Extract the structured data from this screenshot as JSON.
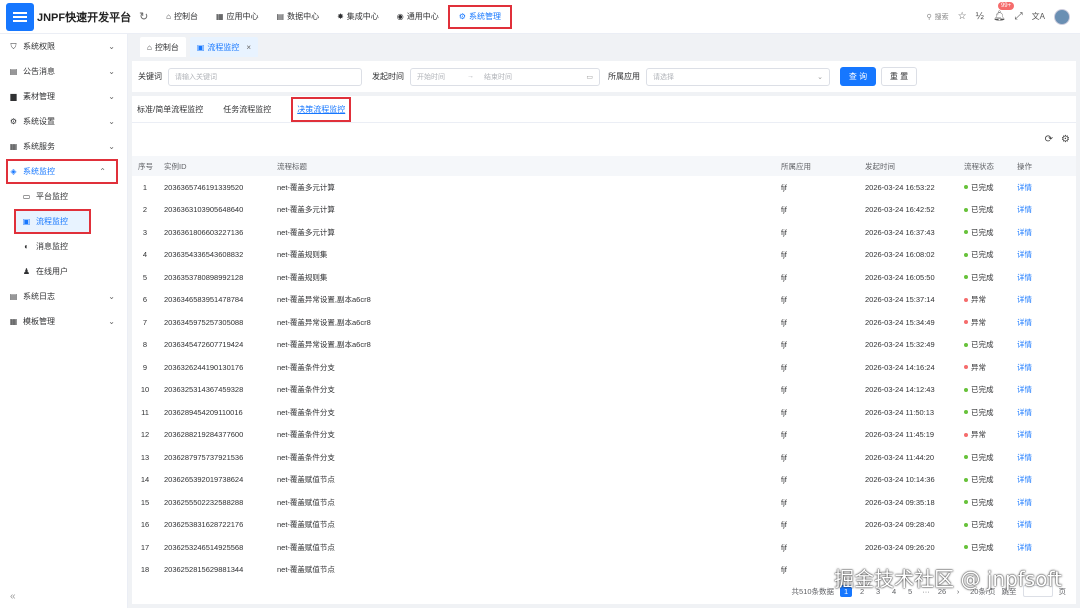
{
  "header": {
    "app_name": "JNPF快速开发平台",
    "nav": [
      {
        "label": "控制台",
        "icon": "home-icon",
        "active": false
      },
      {
        "label": "应用中心",
        "icon": "app-icon",
        "active": false
      },
      {
        "label": "数据中心",
        "icon": "data-icon",
        "active": false
      },
      {
        "label": "集成中心",
        "icon": "integration-icon",
        "active": false
      },
      {
        "label": "通用中心",
        "icon": "general-icon",
        "active": false
      },
      {
        "label": "系统管理",
        "icon": "gear-icon",
        "active": true
      }
    ],
    "search_label": "搜索",
    "badge": "99+"
  },
  "sidebar": {
    "items": [
      {
        "label": "系统权限",
        "icon": "shield-icon",
        "chev": "⌄"
      },
      {
        "label": "公告消息",
        "icon": "notice-icon",
        "chev": "⌄"
      },
      {
        "label": "素材管理",
        "icon": "folder-icon",
        "chev": "⌄"
      },
      {
        "label": "系统设置",
        "icon": "settings-icon",
        "chev": "⌄"
      },
      {
        "label": "系统服务",
        "icon": "service-icon",
        "chev": "⌄"
      },
      {
        "label": "系统监控",
        "icon": "monitor-icon",
        "chev": "⌃"
      },
      {
        "label": "平台监控",
        "icon": "platform-icon"
      },
      {
        "label": "流程监控",
        "icon": "flow-icon"
      },
      {
        "label": "消息监控",
        "icon": "message-icon"
      },
      {
        "label": "在线用户",
        "icon": "user-icon"
      },
      {
        "label": "系统日志",
        "icon": "log-icon",
        "chev": "⌄"
      },
      {
        "label": "模板管理",
        "icon": "template-icon",
        "chev": "⌄"
      }
    ]
  },
  "tabs": [
    {
      "label": "控制台"
    },
    {
      "label": "流程监控",
      "close": "×"
    }
  ],
  "filter": {
    "keyword_label": "关键词",
    "keyword_placeholder": "请输入关键词",
    "date_label": "发起时间",
    "start_placeholder": "开始时间",
    "end_placeholder": "结束时间",
    "app_label": "所属应用",
    "app_placeholder": "请选择",
    "query": "查 询",
    "reset": "重 置"
  },
  "subtabs": [
    {
      "label": "标准/简单流程监控"
    },
    {
      "label": "任务流程监控"
    },
    {
      "label": "决策流程监控"
    }
  ],
  "table": {
    "headers": [
      "序号",
      "实例ID",
      "流程标题",
      "所属应用",
      "发起时间",
      "流程状态",
      "操作"
    ],
    "status_colors": {
      "已完成": "#67c23a",
      "异常": "#f56c6c"
    },
    "rows": [
      [
        "1",
        "2036365746191339520",
        "net-覆盖多元计算",
        "fjf",
        "2026-03-24 16:53:22",
        "已完成",
        "详情"
      ],
      [
        "2",
        "2036363103905648640",
        "net-覆盖多元计算",
        "fjf",
        "2026-03-24 16:42:52",
        "已完成",
        "详情"
      ],
      [
        "3",
        "2036361806603227136",
        "net-覆盖多元计算",
        "fjf",
        "2026-03-24 16:37:43",
        "已完成",
        "详情"
      ],
      [
        "4",
        "2036354336543608832",
        "net-覆盖规则集",
        "fjf",
        "2026-03-24 16:08:02",
        "已完成",
        "详情"
      ],
      [
        "5",
        "2036353780898992128",
        "net-覆盖规则集",
        "fjf",
        "2026-03-24 16:05:50",
        "已完成",
        "详情"
      ],
      [
        "6",
        "2036346583951478784",
        "net-覆盖异常设置,副本a6cr8",
        "fjf",
        "2026-03-24 15:37:14",
        "异常",
        "详情"
      ],
      [
        "7",
        "2036345975257305088",
        "net-覆盖异常设置,副本a6cr8",
        "fjf",
        "2026-03-24 15:34:49",
        "异常",
        "详情"
      ],
      [
        "8",
        "2036345472607719424",
        "net-覆盖异常设置,副本a6cr8",
        "fjf",
        "2026-03-24 15:32:49",
        "已完成",
        "详情"
      ],
      [
        "9",
        "2036326244190130176",
        "net-覆盖条件分支",
        "fjf",
        "2026-03-24 14:16:24",
        "异常",
        "详情"
      ],
      [
        "10",
        "2036325314367459328",
        "net-覆盖条件分支",
        "fjf",
        "2026-03-24 14:12:43",
        "已完成",
        "详情"
      ],
      [
        "11",
        "2036289454209110016",
        "net-覆盖条件分支",
        "fjf",
        "2026-03-24 11:50:13",
        "已完成",
        "详情"
      ],
      [
        "12",
        "2036288219284377600",
        "net-覆盖条件分支",
        "fjf",
        "2026-03-24 11:45:19",
        "异常",
        "详情"
      ],
      [
        "13",
        "2036287975737921536",
        "net-覆盖条件分支",
        "fjf",
        "2026-03-24 11:44:20",
        "已完成",
        "详情"
      ],
      [
        "14",
        "2036265392019738624",
        "net-覆盖赋值节点",
        "fjf",
        "2026-03-24 10:14:36",
        "已完成",
        "详情"
      ],
      [
        "15",
        "2036255502232588288",
        "net-覆盖赋值节点",
        "fjf",
        "2026-03-24 09:35:18",
        "已完成",
        "详情"
      ],
      [
        "16",
        "2036253831628722176",
        "net-覆盖赋值节点",
        "fjf",
        "2026-03-24 09:28:40",
        "已完成",
        "详情"
      ],
      [
        "17",
        "2036253246514925568",
        "net-覆盖赋值节点",
        "fjf",
        "2026-03-24 09:26:20",
        "已完成",
        "详情"
      ],
      [
        "18",
        "2036252815629881344",
        "net-覆盖赋值节点",
        "fjf",
        "",
        "",
        ""
      ]
    ]
  },
  "pagination": {
    "total": "共510条数据",
    "pages": [
      "1",
      "2",
      "3",
      "4",
      "5",
      "···",
      "26",
      "›"
    ],
    "page_size": "20条/页",
    "goto": "跳至",
    "unit": "页"
  },
  "watermark": "掘金技术社区 @ jnpfsoft"
}
